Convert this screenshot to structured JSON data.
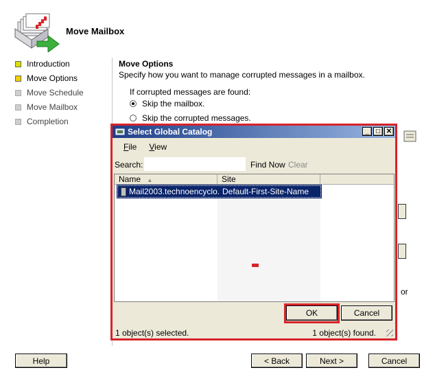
{
  "header": {
    "title": "Move Mailbox"
  },
  "nav": [
    {
      "label": "Introduction",
      "state": "done"
    },
    {
      "label": "Move Options",
      "state": "current"
    },
    {
      "label": "Move Schedule",
      "state": "todo"
    },
    {
      "label": "Move Mailbox",
      "state": "todo"
    },
    {
      "label": "Completion",
      "state": "todo"
    }
  ],
  "content": {
    "title": "Move Options",
    "description": "Specify how you want to manage corrupted messages in a mailbox.",
    "prompt": "If corrupted messages are found:",
    "options": [
      {
        "label": "Skip the mailbox.",
        "selected": true
      },
      {
        "label": "Skip the corrupted messages.",
        "selected": false
      }
    ],
    "partial_text": "or"
  },
  "wizard_buttons": {
    "help": "Help",
    "back": "< Back",
    "next": "Next >",
    "cancel": "Cancel"
  },
  "dialog": {
    "title": "Select Global Catalog",
    "menu": [
      "File",
      "View"
    ],
    "search_label": "Search:",
    "search_value": "",
    "find_now": "Find Now",
    "clear": "Clear",
    "columns": [
      "Name",
      "Site"
    ],
    "rows": [
      {
        "name": "Mail2003.technoencyclo...",
        "site": "Default-First-Site-Name",
        "selected": true
      }
    ],
    "ok": "OK",
    "cancel": "Cancel",
    "status_left": "1 object(s) selected.",
    "status_right": "1 object(s) found."
  },
  "colors": {
    "highlight": "#d8232a",
    "selection": "#0a246a"
  }
}
